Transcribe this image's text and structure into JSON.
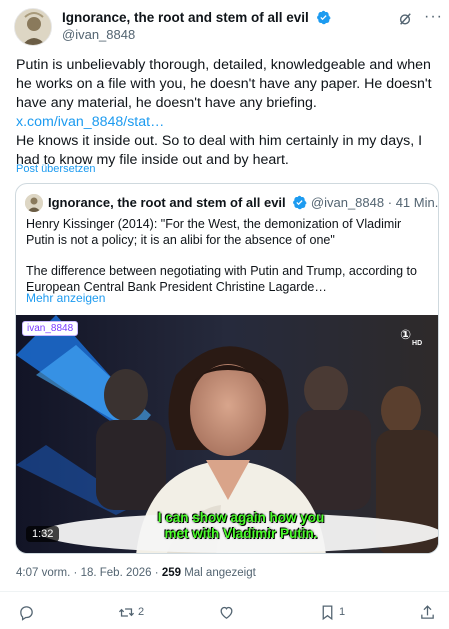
{
  "author": {
    "name": "Ignorance, the root and stem of all evil",
    "handle": "@ivan_8848"
  },
  "header_icons": [
    "grok-icon",
    "more-options-icon"
  ],
  "tweet": {
    "text_1": "Putin is unbelievably thorough, detailed, knowledgeable and when he works on a file with you, he doesn't have any paper. He doesn't have any material, he doesn't have any briefing.",
    "link": "x.com/ivan_8848/stat…",
    "text_2": "He knows it inside out. So to deal with him certainly in my days, I had to know my file inside out and by heart.",
    "translate_label": "Post übersetzen"
  },
  "quote": {
    "name": "Ignorance, the root and stem of all evil",
    "handle": "@ivan_8848",
    "separator": "·",
    "time": "41 Min.",
    "text_1": "Henry Kissinger (2014): \"For the West, the demonization of Vladimir Putin is not a policy; it is an alibi for the absence of one\"",
    "text_2": "The difference between negotiating with Putin and Trump, according to European Central Bank President Christine Lagarde…",
    "more_label": "Mehr anzeigen"
  },
  "video": {
    "watermark": "ivan_8848",
    "channel_logo": "①",
    "channel_hd": "HD",
    "duration": "1:32",
    "subtitle_1": "I can show again how you",
    "subtitle_2": "met with Vladimir Putin."
  },
  "meta": {
    "time": "4:07 vorm.",
    "dot": "·",
    "date": "18. Feb. 2026",
    "views": "259",
    "views_label": "Mal angezeigt"
  },
  "actions": {
    "reply_count": "",
    "repost_count": "2",
    "like_count": "",
    "bookmark_count": "1"
  },
  "colors": {
    "accent": "#1d9bf0",
    "text": "#0f1419",
    "muted": "#536471",
    "subtitle": "#4cff2c"
  }
}
